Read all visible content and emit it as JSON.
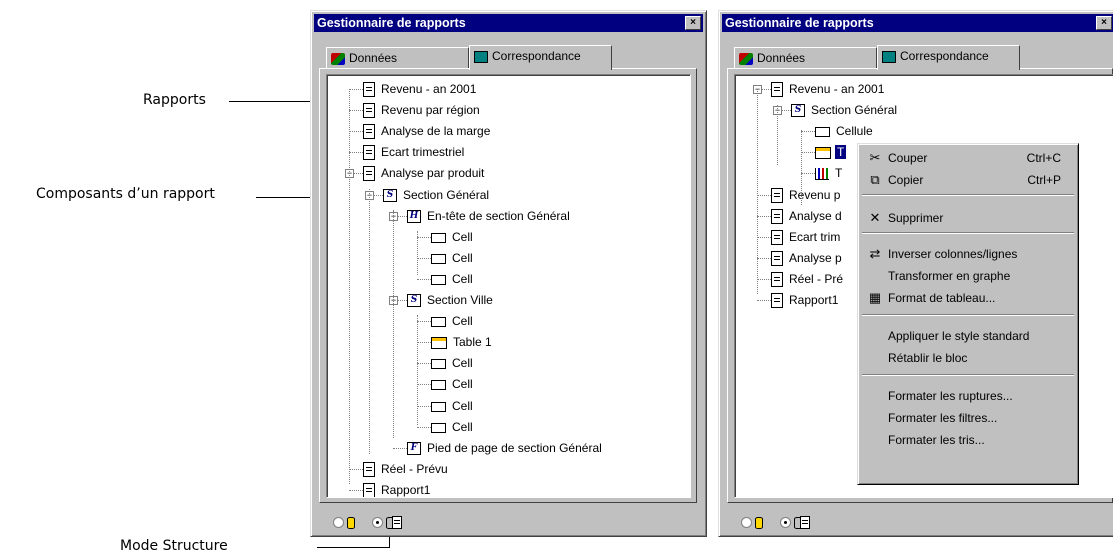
{
  "callouts": {
    "reports": "Rapports",
    "components": "Composants d’un rapport",
    "structure_mode": "Mode Structure"
  },
  "window_left": {
    "title": "Gestionnaire de rapports",
    "close": "×",
    "tabs": [
      "Données",
      "Correspondance"
    ],
    "tree": [
      {
        "label": "Revenu - an 2001",
        "icon": "report-icon"
      },
      {
        "label": "Revenu par région",
        "icon": "report-icon"
      },
      {
        "label": "Analyse de la marge",
        "icon": "report-icon"
      },
      {
        "label": "Ecart trimestriel",
        "icon": "report-icon"
      },
      {
        "label": "Analyse par produit",
        "icon": "report-icon"
      },
      {
        "label": "Section Général",
        "icon": "section-icon",
        "glyph": "S"
      },
      {
        "label": "En-tête de section Général",
        "icon": "header-icon",
        "glyph": "H"
      },
      {
        "label": "Cell",
        "icon": "cell-icon"
      },
      {
        "label": "Cell",
        "icon": "cell-icon"
      },
      {
        "label": "Cell",
        "icon": "cell-icon"
      },
      {
        "label": "Section Ville",
        "icon": "section-icon",
        "glyph": "S"
      },
      {
        "label": "Cell",
        "icon": "cell-icon"
      },
      {
        "label": "Table 1",
        "icon": "table-icon"
      },
      {
        "label": "Cell",
        "icon": "cell-icon"
      },
      {
        "label": "Cell",
        "icon": "cell-icon"
      },
      {
        "label": "Cell",
        "icon": "cell-icon"
      },
      {
        "label": "Cell",
        "icon": "cell-icon"
      },
      {
        "label": "Pied de page de section Général",
        "icon": "footer-icon",
        "glyph": "F"
      },
      {
        "label": "Réel - Prévu",
        "icon": "report-icon"
      },
      {
        "label": "Rapport1",
        "icon": "report-icon"
      }
    ],
    "mode_selected": "structure"
  },
  "window_right": {
    "title": "Gestionnaire de rapports",
    "close": "×",
    "tabs": [
      "Données",
      "Correspondance"
    ],
    "tree": [
      {
        "label": "Revenu - an 2001",
        "icon": "report-icon"
      },
      {
        "label": "Section Général",
        "icon": "section-icon",
        "glyph": "S"
      },
      {
        "label": "Cellule",
        "icon": "cell-icon"
      },
      {
        "label": "T",
        "icon": "table-icon",
        "selected": true
      },
      {
        "label": "T",
        "icon": "chart-icon"
      },
      {
        "label": "Revenu p",
        "icon": "report-icon"
      },
      {
        "label": "Analyse d",
        "icon": "report-icon"
      },
      {
        "label": "Ecart trim",
        "icon": "report-icon"
      },
      {
        "label": "Analyse p",
        "icon": "report-icon"
      },
      {
        "label": "Réel - Pré",
        "icon": "report-icon"
      },
      {
        "label": "Rapport1",
        "icon": "report-icon"
      }
    ],
    "mode_selected": "structure"
  },
  "context_menu": {
    "items": [
      {
        "label": "Couper",
        "shortcut": "Ctrl+C",
        "icon": "scissors-icon",
        "glyph": "✂"
      },
      {
        "label": "Copier",
        "shortcut": "Ctrl+P",
        "icon": "copy-icon",
        "glyph": "⧉"
      },
      {
        "label": "Supprimer",
        "shortcut": "",
        "icon": "delete-icon",
        "glyph": "✕"
      },
      {
        "label": "Inverser colonnes/lignes",
        "shortcut": "",
        "icon": "pivot-icon",
        "glyph": "⇄"
      },
      {
        "label": "Transformer en graphe",
        "shortcut": "",
        "icon": "",
        "glyph": ""
      },
      {
        "label": "Format de tableau...",
        "shortcut": "",
        "icon": "table-format-icon",
        "glyph": "▦"
      },
      {
        "label": "Appliquer le style standard",
        "shortcut": "",
        "icon": "",
        "glyph": ""
      },
      {
        "label": "Rétablir le bloc",
        "shortcut": "",
        "icon": "",
        "glyph": ""
      },
      {
        "label": "Formater les ruptures...",
        "shortcut": "",
        "icon": "",
        "glyph": ""
      },
      {
        "label": "Formater les filtres...",
        "shortcut": "",
        "icon": "",
        "glyph": ""
      },
      {
        "label": "Formater les tris...",
        "shortcut": "",
        "icon": "",
        "glyph": ""
      }
    ]
  },
  "colors": {
    "titlebar": "#000080",
    "face": "#c0c0c0",
    "selection": "#000080"
  }
}
